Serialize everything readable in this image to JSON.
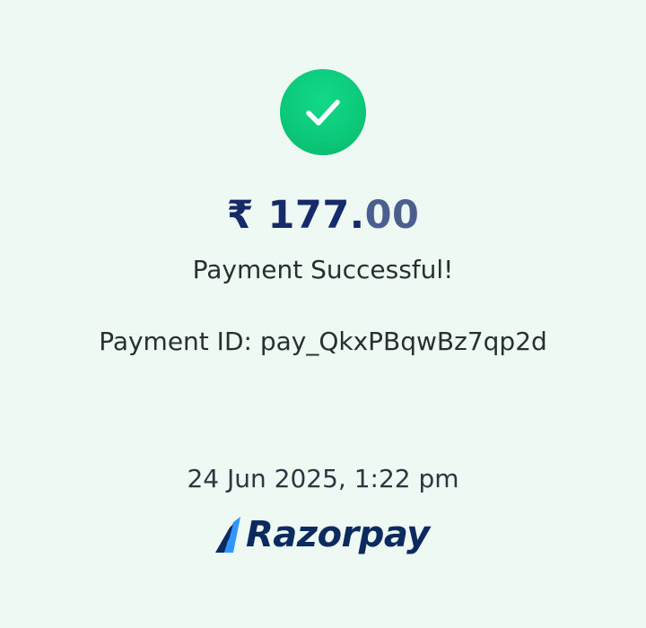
{
  "payment": {
    "currency_symbol": "₹",
    "amount_whole": "177.",
    "amount_fraction": "00",
    "status": "Payment Successful!",
    "payment_id": "Payment ID: pay_QkxPBqwBz7qp2d",
    "datetime": "24 Jun 2025, 1:22 pm"
  },
  "brand": {
    "name": "Razorpay"
  },
  "icons": {
    "success": "checkmark-circle-icon",
    "brand_mark": "razorpay-logo-icon"
  },
  "colors": {
    "background": "#eef9f4",
    "success_green": "#0cc97a",
    "amount_navy": "#142a6b",
    "brand_navy": "#0b2a5e",
    "brand_blue": "#3395ff"
  }
}
